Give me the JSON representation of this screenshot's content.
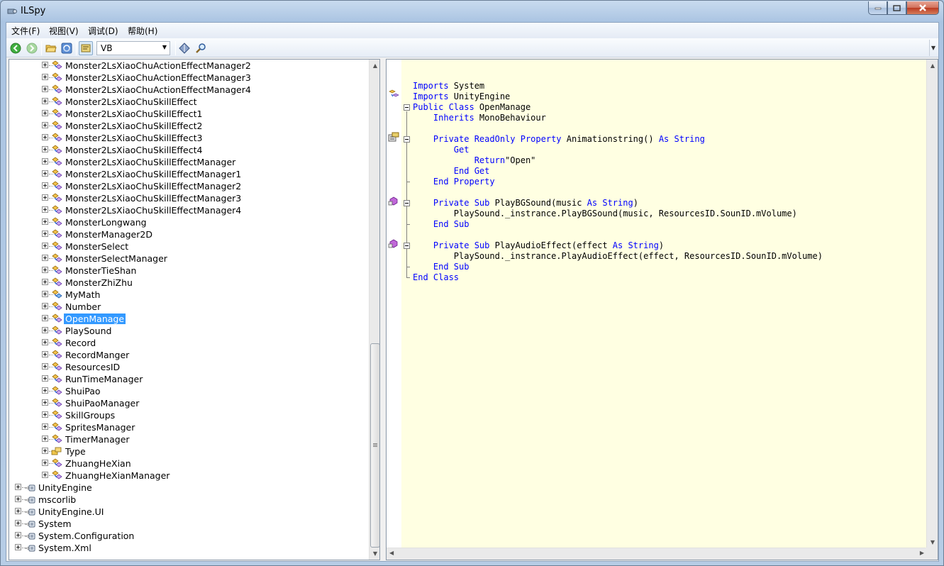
{
  "window": {
    "title": "ILSpy"
  },
  "menu": [
    "文件(F)",
    "视图(V)",
    "调试(D)",
    "帮助(H)"
  ],
  "toolbar": {
    "language": "VB"
  },
  "tree": {
    "selected": "OpenManage",
    "class_items": [
      {
        "label": "Monster2LsXiaoChuActionEffectManager2",
        "icon": "class-icon"
      },
      {
        "label": "Monster2LsXiaoChuActionEffectManager3",
        "icon": "class-icon"
      },
      {
        "label": "Monster2LsXiaoChuActionEffectManager4",
        "icon": "class-icon"
      },
      {
        "label": "Monster2LsXiaoChuSkillEffect",
        "icon": "class-icon"
      },
      {
        "label": "Monster2LsXiaoChuSkillEffect1",
        "icon": "class-icon"
      },
      {
        "label": "Monster2LsXiaoChuSkillEffect2",
        "icon": "class-icon"
      },
      {
        "label": "Monster2LsXiaoChuSkillEffect3",
        "icon": "class-icon"
      },
      {
        "label": "Monster2LsXiaoChuSkillEffect4",
        "icon": "class-icon"
      },
      {
        "label": "Monster2LsXiaoChuSkillEffectManager",
        "icon": "class-icon"
      },
      {
        "label": "Monster2LsXiaoChuSkillEffectManager1",
        "icon": "class-icon"
      },
      {
        "label": "Monster2LsXiaoChuSkillEffectManager2",
        "icon": "class-icon"
      },
      {
        "label": "Monster2LsXiaoChuSkillEffectManager3",
        "icon": "class-icon"
      },
      {
        "label": "Monster2LsXiaoChuSkillEffectManager4",
        "icon": "class-icon"
      },
      {
        "label": "MonsterLongwang",
        "icon": "class-icon"
      },
      {
        "label": "MonsterManager2D",
        "icon": "class-icon"
      },
      {
        "label": "MonsterSelect",
        "icon": "class-icon"
      },
      {
        "label": "MonsterSelectManager",
        "icon": "class-icon"
      },
      {
        "label": "MonsterTieShan",
        "icon": "class-icon"
      },
      {
        "label": "MonsterZhiZhu",
        "icon": "class-icon"
      },
      {
        "label": "MyMath",
        "icon": "static-class-icon"
      },
      {
        "label": "Number",
        "icon": "class-icon"
      },
      {
        "label": "OpenManage",
        "icon": "class-icon"
      },
      {
        "label": "PlaySound",
        "icon": "class-icon"
      },
      {
        "label": "Record",
        "icon": "class-icon"
      },
      {
        "label": "RecordManger",
        "icon": "class-icon"
      },
      {
        "label": "ResourcesID",
        "icon": "class-icon"
      },
      {
        "label": "RunTimeManager",
        "icon": "class-icon"
      },
      {
        "label": "ShuiPao",
        "icon": "class-icon"
      },
      {
        "label": "ShuiPaoManager",
        "icon": "class-icon"
      },
      {
        "label": "SkillGroups",
        "icon": "class-icon"
      },
      {
        "label": "SpritesManager",
        "icon": "class-icon"
      },
      {
        "label": "TimerManager",
        "icon": "class-icon"
      },
      {
        "label": "Type",
        "icon": "enum-icon"
      },
      {
        "label": "ZhuangHeXian",
        "icon": "class-icon"
      },
      {
        "label": "ZhuangHeXianManager",
        "icon": "class-icon"
      }
    ],
    "assemblies": [
      "UnityEngine",
      "mscorlib",
      "UnityEngine.UI",
      "System",
      "System.Configuration",
      "System.Xml"
    ]
  },
  "code": {
    "lines": [
      [
        [
          "kw",
          "Imports"
        ],
        [
          "pl",
          " System"
        ]
      ],
      [
        [
          "kw",
          "Imports"
        ],
        [
          "pl",
          " UnityEngine"
        ]
      ],
      [
        [
          "kw",
          "Public Class"
        ],
        [
          "pl",
          " OpenManage"
        ]
      ],
      [
        [
          "pl",
          "    "
        ],
        [
          "kw",
          "Inherits"
        ],
        [
          "pl",
          " MonoBehaviour"
        ]
      ],
      [],
      [
        [
          "pl",
          "    "
        ],
        [
          "kw",
          "Private ReadOnly Property"
        ],
        [
          "pl",
          " Animationstring() "
        ],
        [
          "kw",
          "As String"
        ]
      ],
      [
        [
          "pl",
          "        "
        ],
        [
          "kw",
          "Get"
        ]
      ],
      [
        [
          "pl",
          "            "
        ],
        [
          "kw",
          "Return"
        ],
        [
          "pl",
          "\"Open\""
        ]
      ],
      [
        [
          "pl",
          "        "
        ],
        [
          "kw",
          "End Get"
        ]
      ],
      [
        [
          "pl",
          "    "
        ],
        [
          "kw",
          "End Property"
        ]
      ],
      [],
      [
        [
          "pl",
          "    "
        ],
        [
          "kw",
          "Private Sub"
        ],
        [
          "pl",
          " PlayBGSound(music "
        ],
        [
          "kw",
          "As String"
        ],
        [
          "pl",
          ")"
        ]
      ],
      [
        [
          "pl",
          "        PlaySound._instrance.PlayBGSound(music, ResourcesID.SounID.mVolume)"
        ]
      ],
      [
        [
          "pl",
          "    "
        ],
        [
          "kw",
          "End Sub"
        ]
      ],
      [],
      [
        [
          "pl",
          "    "
        ],
        [
          "kw",
          "Private Sub"
        ],
        [
          "pl",
          " PlayAudioEffect(effect "
        ],
        [
          "kw",
          "As String"
        ],
        [
          "pl",
          ")"
        ]
      ],
      [
        [
          "pl",
          "        PlaySound._instrance.PlayAudioEffect(effect, ResourcesID.SounID.mVolume)"
        ]
      ],
      [
        [
          "pl",
          "    "
        ],
        [
          "kw",
          "End Sub"
        ]
      ],
      [
        [
          "kw",
          "End Class"
        ]
      ]
    ]
  },
  "colors": {
    "keyword": "#0000ff",
    "code_bg": "#ffffe2",
    "selection": "#3399ff"
  }
}
